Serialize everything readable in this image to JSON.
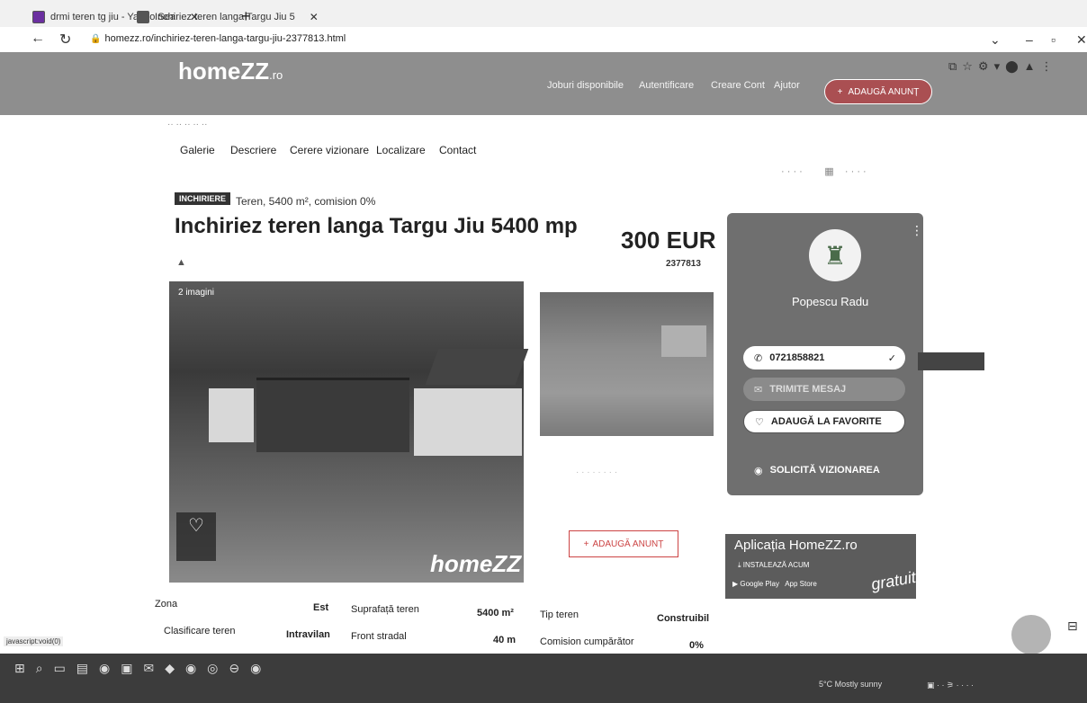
{
  "browser": {
    "tabs": [
      {
        "label": "drmi teren tg jiu - Yahoo Sea"
      },
      {
        "label": "Inchiriez teren langa Targu Jiu 5"
      }
    ],
    "url": "homezz.ro/inchiriez-teren-langa-targu-jiu-2377813.html"
  },
  "header": {
    "logo_text": "homeZZ",
    "logo_suffix": ".ro",
    "nav": [
      "Joburi disponibile",
      "Autentificare",
      "Creare Cont",
      "Ajutor"
    ],
    "post_button": "ADAUGĂ ANUNȚ"
  },
  "page_tabs": [
    "Galerie",
    "Descriere",
    "Cerere vizionare",
    "Localizare",
    "Contact"
  ],
  "listing": {
    "badge": "INCHIRIERE",
    "subtitle": "Teren, 5400 m², comision 0%",
    "title": "Inchiriez teren langa Targu Jiu 5400 mp",
    "price": "300 EUR",
    "ad_id": "2377813",
    "photo_count": "2 imagini",
    "watermark": "homeZZ",
    "post_button_label": "ADAUGĂ ANUNȚ"
  },
  "agent": {
    "name": "Popescu Radu",
    "phone": "0721858821",
    "message_label": "TRIMITE MESAJ",
    "favorite_label": "ADAUGĂ LA FAVORITE",
    "visit_label": "SOLICITĂ VIZIONAREA"
  },
  "app_promo": {
    "title": "Aplicația HomeZZ.ro",
    "install_label": "INSTALEAZĂ ACUM",
    "google_play": "Google Play",
    "app_store": "App Store",
    "free_label": "gratuit"
  },
  "specs": [
    {
      "label": "Zona",
      "value": "Est"
    },
    {
      "label": "Suprafață teren",
      "value": "5400 m²"
    },
    {
      "label": "Tip teren",
      "value": "Construibil"
    },
    {
      "label": "Clasificare teren",
      "value": "Intravilan"
    },
    {
      "label": "Front stradal",
      "value": "40 m"
    },
    {
      "label": "Comision cumpărător",
      "value": "0%"
    }
  ],
  "status_url": "javascript:void(0)",
  "taskbar": {
    "weather": "5°C Mostly sunny"
  },
  "icons": [
    "back-icon",
    "reload-icon",
    "lock-icon",
    "heart-icon",
    "phone-icon",
    "check-icon",
    "message-icon",
    "eye-icon",
    "plus-icon",
    "more-icon"
  ]
}
